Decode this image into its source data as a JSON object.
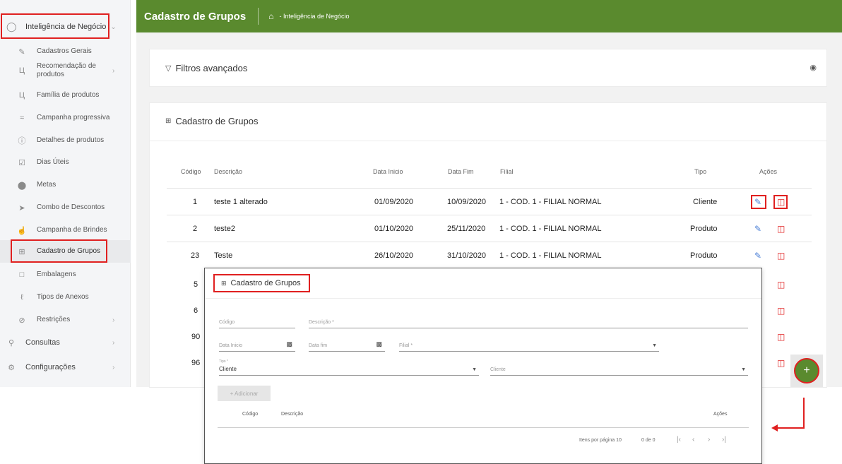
{
  "header": {
    "title": "Cadastro de Grupos",
    "home_icon": "home-icon",
    "breadcrumb": "- Inteligência de Negócio"
  },
  "sidebar": {
    "top": {
      "label": "Inteligência de Negócio",
      "icon": "bulb-icon"
    },
    "items": [
      {
        "label": "Cadastros Gerais",
        "icon": "edit-icon"
      },
      {
        "label": "Recomendação de produtos",
        "icon": "cart-icon"
      },
      {
        "label": "Família de produtos",
        "icon": "cart-icon"
      },
      {
        "label": "Campanha progressiva",
        "icon": "chart-icon"
      },
      {
        "label": "Detalhes de produtos",
        "icon": "info-icon"
      },
      {
        "label": "Dias Úteis",
        "icon": "calendar-check-icon"
      },
      {
        "label": "Metas",
        "icon": "target-icon"
      },
      {
        "label": "Combo de Descontos",
        "icon": "tag-icon"
      },
      {
        "label": "Campanha de Brindes",
        "icon": "gift-icon"
      },
      {
        "label": "Cadastro de Grupos",
        "icon": "grid-icon"
      },
      {
        "label": "Embalagens",
        "icon": "box-icon"
      },
      {
        "label": "Tipos de Anexos",
        "icon": "paperclip-icon"
      },
      {
        "label": "Restrições",
        "icon": "block-icon"
      }
    ],
    "bottom": [
      {
        "label": "Consultas",
        "icon": "search-icon"
      },
      {
        "label": "Configurações",
        "icon": "gear-icon"
      }
    ]
  },
  "filters": {
    "label": "Filtros avançados"
  },
  "groups_card": {
    "title": "Cadastro de Grupos"
  },
  "table": {
    "headers": {
      "codigo": "Código",
      "descricao": "Descrição",
      "data_inicio": "Data Inicio",
      "data_fim": "Data Fim",
      "filial": "Filial",
      "tipo": "Tipo",
      "acoes": "Ações"
    },
    "rows": [
      {
        "codigo": "1",
        "descricao": "teste 1 alterado",
        "data_inicio": "01/09/2020",
        "data_fim": "10/09/2020",
        "filial": "1 - COD. 1 - FILIAL NORMAL",
        "tipo": "Cliente"
      },
      {
        "codigo": "2",
        "descricao": "teste2",
        "data_inicio": "01/10/2020",
        "data_fim": "25/11/2020",
        "filial": "1 - COD. 1 - FILIAL NORMAL",
        "tipo": "Produto"
      },
      {
        "codigo": "23",
        "descricao": "Teste",
        "data_inicio": "26/10/2020",
        "data_fim": "31/10/2020",
        "filial": "1 - COD. 1 - FILIAL NORMAL",
        "tipo": "Produto"
      },
      {
        "codigo": "5"
      },
      {
        "codigo": "6"
      },
      {
        "codigo": "90"
      },
      {
        "codigo": "96"
      }
    ]
  },
  "modal": {
    "title": "Cadastro de Grupos",
    "codigo_placeholder": "Código",
    "descricao_placeholder": "Descrição *",
    "data_inicio_placeholder": "Data Inicio",
    "data_fim_placeholder": "Data fim",
    "filial_placeholder": "Filial *",
    "tipo_label": "Tipo *",
    "tipo_value": "Cliente",
    "cliente_placeholder": "Cliente",
    "add_button": "+ Adicionar",
    "col_codigo": "Código",
    "col_descricao": "Descrição",
    "col_acoes": "Ações",
    "items_per_page": "Itens por página 10",
    "range": "0 de 0"
  },
  "fab": {
    "label": "+"
  },
  "colors": {
    "brand_green": "#5a8a2e",
    "highlight_red": "#e02020",
    "edit_blue": "#4a7fd6"
  }
}
